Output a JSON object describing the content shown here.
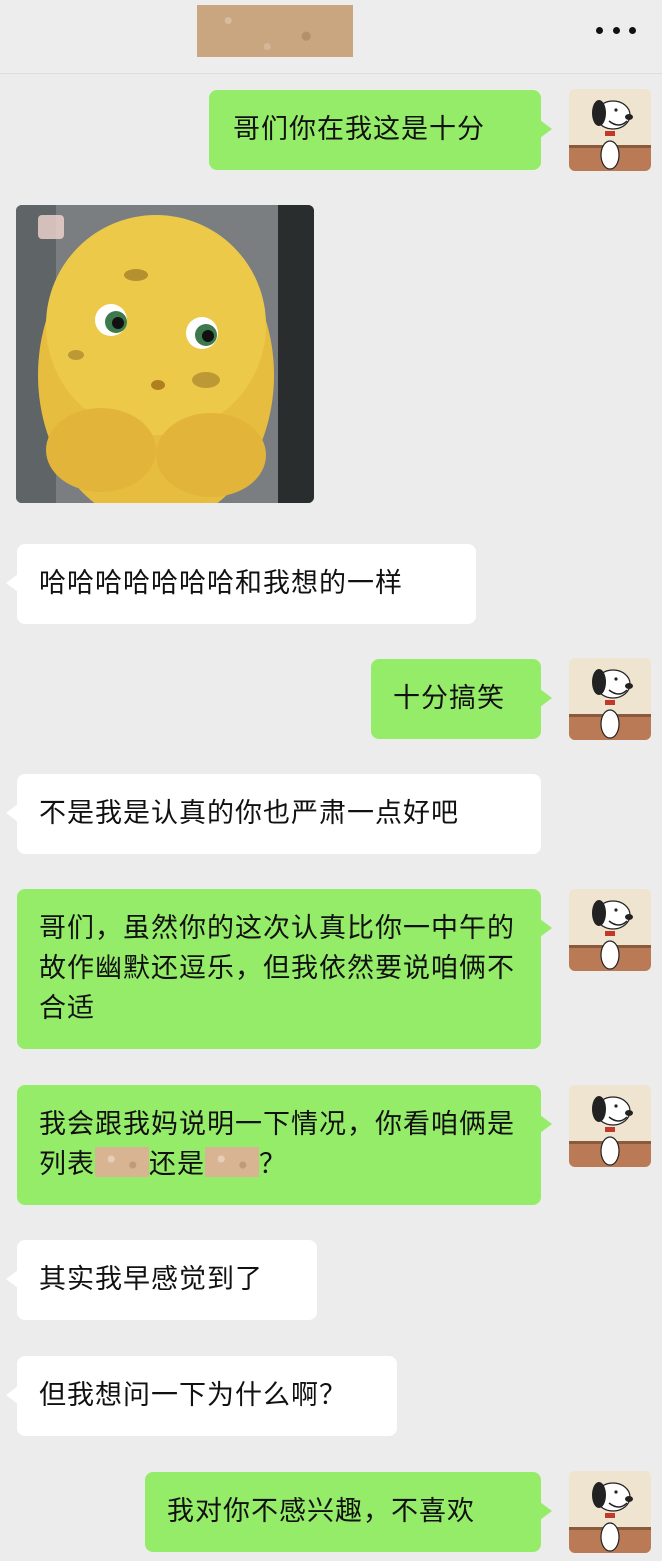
{
  "header": {
    "more_icon": "more-dots-icon"
  },
  "messages": [
    {
      "side": "right",
      "text": "哥们你在我这是十分"
    },
    {
      "side": "left",
      "type": "sticker",
      "sticker_icon": "potato-character-sticker"
    },
    {
      "side": "left",
      "text": "哈哈哈哈哈哈哈和我想的一样"
    },
    {
      "side": "right",
      "text": "十分搞笑"
    },
    {
      "side": "left",
      "text": "不是我是认真的你也严肃一点好吧"
    },
    {
      "side": "right",
      "text": "哥们，虽然你的这次认真比你一中午的故作幽默还逗乐，但我依然要说咱俩不合适"
    },
    {
      "side": "right",
      "text_parts": [
        "我会跟我妈说明一下情况，你看咱俩是列表",
        "还是",
        "？"
      ]
    },
    {
      "side": "left",
      "text": "其实我早感觉到了"
    },
    {
      "side": "left",
      "text": "但我想问一下为什么啊？"
    },
    {
      "side": "right",
      "text": "我对你不感兴趣，不喜欢"
    }
  ],
  "avatar_icon": "snoopy-avatar-icon",
  "colors": {
    "background": "#ececec",
    "right_bubble": "#95ec69",
    "left_bubble": "#ffffff",
    "text": "#111111"
  }
}
